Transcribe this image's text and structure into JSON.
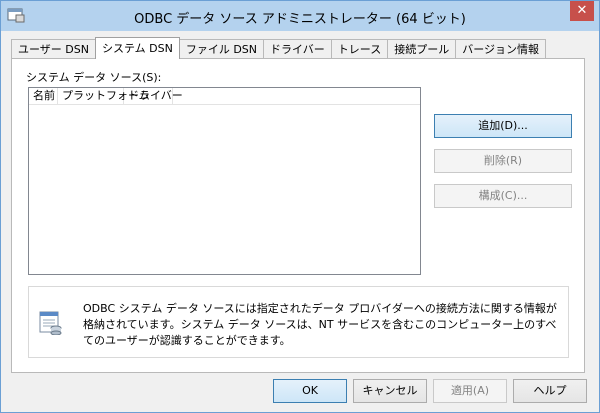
{
  "window": {
    "title": "ODBC データ ソース アドミニストレーター (64 ビット)",
    "close_label": "✕"
  },
  "tabs": [
    {
      "label": "ユーザー DSN",
      "active": false
    },
    {
      "label": "システム DSN",
      "active": true
    },
    {
      "label": "ファイル DSN",
      "active": false
    },
    {
      "label": "ドライバー",
      "active": false
    },
    {
      "label": "トレース",
      "active": false
    },
    {
      "label": "接続プール",
      "active": false
    },
    {
      "label": "バージョン情報",
      "active": false
    }
  ],
  "panel": {
    "section_label": "システム データ ソース(S):",
    "columns": [
      "名前",
      "プラットフォーム",
      "ドライバー"
    ],
    "rows": [],
    "buttons": {
      "add": "追加(D)...",
      "remove": "削除(R)",
      "configure": "構成(C)..."
    },
    "info_text": "ODBC システム データ ソースには指定されたデータ プロバイダーへの接続方法に関する情報が格納されています。システム データ ソースは、NT サービスを含むこのコンピューター上のすべてのユーザーが認識することができます。"
  },
  "footer": {
    "ok": "OK",
    "cancel": "キャンセル",
    "apply": "適用(A)",
    "help": "ヘルプ"
  },
  "colors": {
    "titlebar": "#b4d2ee",
    "close": "#c7504b",
    "primary_border": "#3c7fb1"
  },
  "icons": {
    "app": "odbc-app-icon",
    "info": "database-info-icon"
  }
}
